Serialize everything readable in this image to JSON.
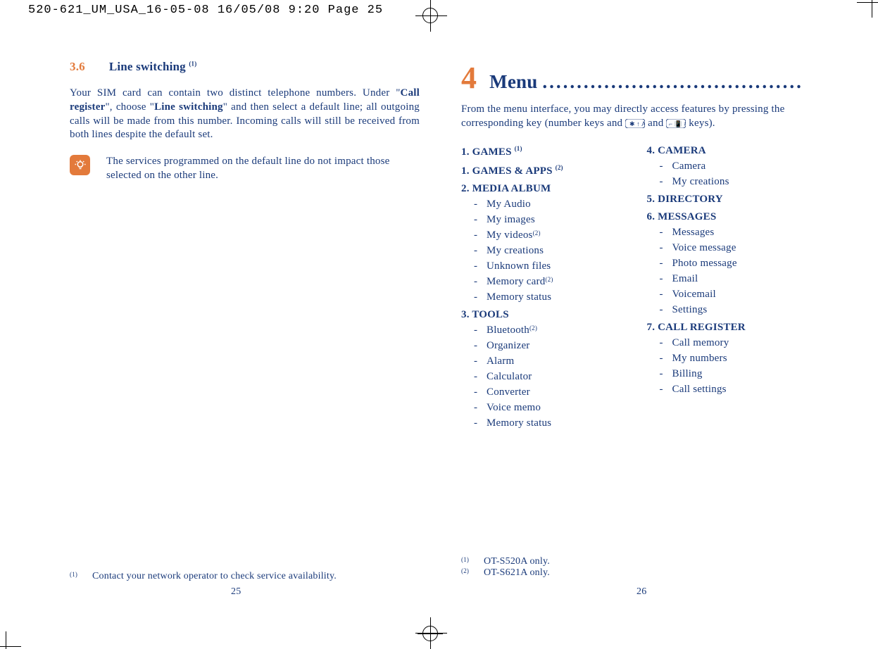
{
  "printer_header": "520-621_UM_USA_16-05-08  16/05/08  9:20  Page 25",
  "left": {
    "sec_num": "3.6",
    "sec_title": "Line switching ",
    "sec_title_sup": "(1)",
    "body": {
      "p1_a": "Your SIM card can contain two distinct telephone numbers. Under \"",
      "p1_b": "Call register",
      "p1_c": "\", choose \"",
      "p1_d": "Line switching",
      "p1_e": "\" and then select a default line; all outgoing calls will be made from this number. Incoming calls will still be received from both lines despite the default set."
    },
    "note": "The services programmed on the default line do not impact those selected on the other line.",
    "footnote_sup": "(1)",
    "footnote": "Contact your network operator to check service availability.",
    "page_num": "25"
  },
  "right": {
    "big_num": "4",
    "chap_title": "Menu ",
    "dots": "......................................",
    "intro_a": "From the menu interface, you may directly access features by pressing the corresponding key (number keys and ",
    "intro_mid": " and ",
    "intro_end": " keys).",
    "col1": {
      "h1": "1. GAMES ",
      "h1_sup": "(1)",
      "h2": "1. GAMES & APPS ",
      "h2_sup": "(2)",
      "h3": "2. MEDIA ALBUM",
      "m3": [
        "My Audio",
        "My images",
        "My videos ",
        "My creations",
        "Unknown files",
        "Memory card ",
        "Memory status"
      ],
      "m3_sup_idx": {
        "2": "(2)",
        "5": "(2)"
      },
      "h4": "3. TOOLS",
      "m4": [
        "Bluetooth ",
        "Organizer",
        "Alarm",
        "Calculator",
        "Converter",
        "Voice memo",
        "Memory status"
      ],
      "m4_sup_idx": {
        "0": "(2)"
      }
    },
    "col2": {
      "h5": "4. CAMERA",
      "m5": [
        "Camera",
        "My creations"
      ],
      "h6": "5. DIRECTORY",
      "h7": "6. MESSAGES",
      "m7": [
        "Messages",
        "Voice message",
        "Photo message",
        "Email",
        "Voicemail",
        "Settings"
      ],
      "h8": "7. CALL REGISTER",
      "m8": [
        "Call memory",
        "My numbers",
        "Billing",
        "Call settings"
      ]
    },
    "footnote1_sup": "(1)",
    "footnote1": "OT-S520A only.",
    "footnote2_sup": "(2)",
    "footnote2": "OT-S621A only.",
    "page_num": "26"
  }
}
